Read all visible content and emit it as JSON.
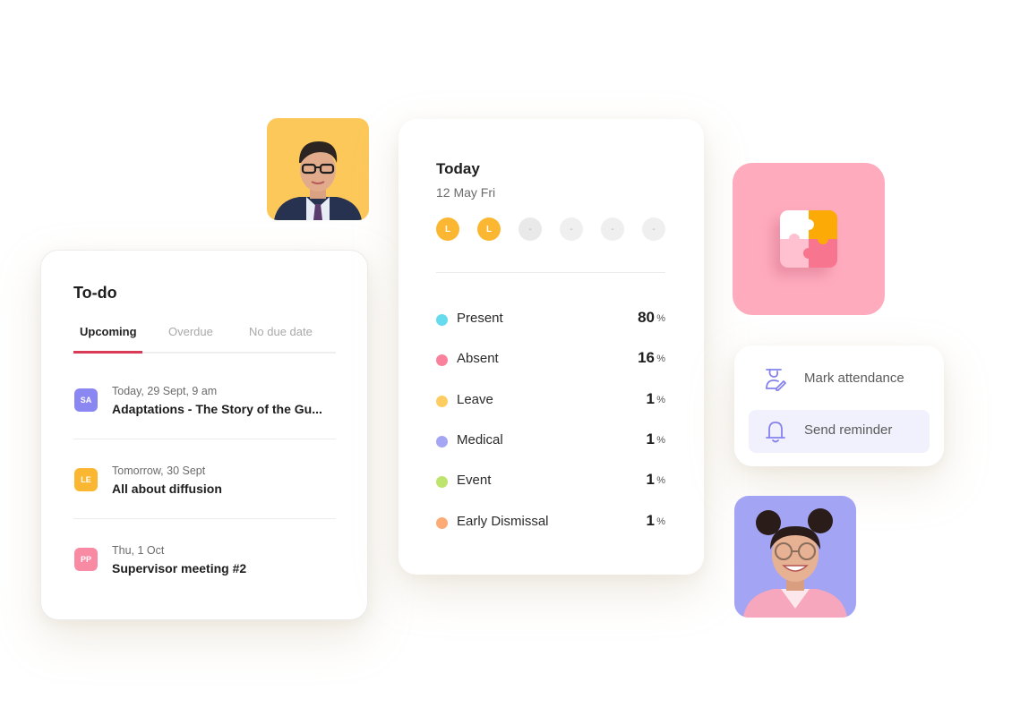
{
  "todo": {
    "title": "To-do",
    "tabs": [
      {
        "label": "Upcoming",
        "active": true
      },
      {
        "label": "Overdue",
        "active": false
      },
      {
        "label": "No due date",
        "active": false
      }
    ],
    "items": [
      {
        "initials": "SA",
        "badge_color": "#8b87f2",
        "date": "Today, 29 Sept, 9 am",
        "name": "Adaptations - The Story of the Gu..."
      },
      {
        "initials": "LE",
        "badge_color": "#fbb731",
        "date": "Tomorrow, 30 Sept",
        "name": "All about diffusion"
      },
      {
        "initials": "PP",
        "badge_color": "#f98aa3",
        "date": "Thu, 1 Oct",
        "name": "Supervisor meeting #2"
      }
    ],
    "accent": "#d93a56"
  },
  "today": {
    "title": "Today",
    "date": "12 May Fri",
    "periods": [
      {
        "label": "L",
        "state": "filled"
      },
      {
        "label": "L",
        "state": "filled"
      },
      {
        "label": "-",
        "state": "empty"
      },
      {
        "label": "-",
        "state": "empty"
      },
      {
        "label": "-",
        "state": "empty"
      },
      {
        "label": "-",
        "state": "empty"
      }
    ],
    "stats": [
      {
        "label": "Present",
        "value": "80",
        "unit": "%",
        "color": "#67dbee"
      },
      {
        "label": "Absent",
        "value": "16",
        "unit": "%",
        "color": "#f9819c"
      },
      {
        "label": "Leave",
        "value": "1",
        "unit": "%",
        "color": "#fdcd62"
      },
      {
        "label": "Medical",
        "value": "1",
        "unit": "%",
        "color": "#a5a5f6"
      },
      {
        "label": "Event",
        "value": "1",
        "unit": "%",
        "color": "#bde46c"
      },
      {
        "label": "Early Dismissal",
        "value": "1",
        "unit": "%",
        "color": "#fdab74"
      }
    ]
  },
  "actions": {
    "items": [
      {
        "label": "Mark attendance",
        "icon": "mark-attendance-icon",
        "highlighted": false
      },
      {
        "label": "Send reminder",
        "icon": "bell-icon",
        "highlighted": true
      }
    ],
    "icon_color": "#8582ef"
  },
  "photos": {
    "boy_bg": "#fdc85a",
    "woman_bg": "#a3a4f3"
  },
  "puzzle": {
    "tile_bg": "#ffabbe",
    "piece_colors": [
      "#ffffff",
      "#fcaa05",
      "#ffc0cf",
      "#f7758f"
    ]
  }
}
